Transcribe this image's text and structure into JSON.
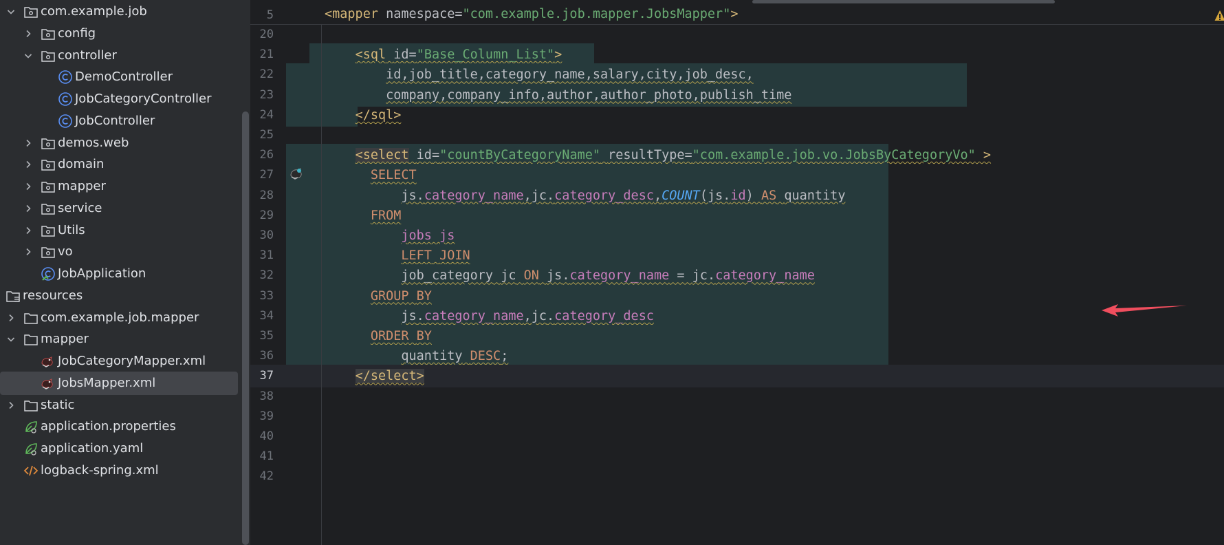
{
  "tree": {
    "items": [
      {
        "label": "com.example.job",
        "indent": 0,
        "chevron": "down",
        "icon": "package-icon"
      },
      {
        "label": "config",
        "indent": 1,
        "chevron": "right",
        "icon": "package-icon"
      },
      {
        "label": "controller",
        "indent": 1,
        "chevron": "down",
        "icon": "package-icon"
      },
      {
        "label": "DemoController",
        "indent": 2,
        "chevron": "",
        "icon": "class-icon"
      },
      {
        "label": "JobCategoryController",
        "indent": 2,
        "chevron": "",
        "icon": "class-icon"
      },
      {
        "label": "JobController",
        "indent": 2,
        "chevron": "",
        "icon": "class-icon"
      },
      {
        "label": "demos.web",
        "indent": 1,
        "chevron": "right",
        "icon": "package-icon"
      },
      {
        "label": "domain",
        "indent": 1,
        "chevron": "right",
        "icon": "package-icon"
      },
      {
        "label": "mapper",
        "indent": 1,
        "chevron": "right",
        "icon": "package-icon"
      },
      {
        "label": "service",
        "indent": 1,
        "chevron": "right",
        "icon": "package-icon"
      },
      {
        "label": "Utils",
        "indent": 1,
        "chevron": "right",
        "icon": "package-icon"
      },
      {
        "label": "vo",
        "indent": 1,
        "chevron": "right",
        "icon": "package-icon"
      },
      {
        "label": "JobApplication",
        "indent": 1,
        "chevron": "",
        "icon": "spring-app-icon"
      },
      {
        "label": "resources",
        "indent": -1,
        "chevron": "",
        "icon": "resources-folder-icon"
      },
      {
        "label": "com.example.job.mapper",
        "indent": 0,
        "chevron": "right",
        "icon": "folder-icon"
      },
      {
        "label": "mapper",
        "indent": 0,
        "chevron": "down",
        "icon": "folder-icon"
      },
      {
        "label": "JobCategoryMapper.xml",
        "indent": 1,
        "chevron": "",
        "icon": "mybatis-xml-icon"
      },
      {
        "label": "JobsMapper.xml",
        "indent": 1,
        "chevron": "",
        "icon": "mybatis-xml-icon",
        "selected": true
      },
      {
        "label": "static",
        "indent": 0,
        "chevron": "right",
        "icon": "folder-icon"
      },
      {
        "label": "application.properties",
        "indent": 0,
        "chevron": "",
        "icon": "spring-config-icon"
      },
      {
        "label": "application.yaml",
        "indent": 0,
        "chevron": "",
        "icon": "spring-config-icon"
      },
      {
        "label": "logback-spring.xml",
        "indent": 0,
        "chevron": "",
        "icon": "xml-file-icon"
      }
    ]
  },
  "editor": {
    "sticky": {
      "num": "5",
      "text": "<mapper namespace=\"com.example.job.mapper.JobsMapper\">"
    },
    "current_line": "37",
    "lines": [
      {
        "num": "20",
        "text": ""
      },
      {
        "num": "21",
        "text": "    <sql id=\"Base_Column_List\">"
      },
      {
        "num": "22",
        "text": "        id,job_title,category_name,salary,city,job_desc,"
      },
      {
        "num": "23",
        "text": "        company,company_info,author,author_photo,publish_time"
      },
      {
        "num": "24",
        "text": "    </sql>"
      },
      {
        "num": "25",
        "text": ""
      },
      {
        "num": "26",
        "text": "    <select id=\"countByCategoryName\" resultType=\"com.example.job.vo.JobsByCategoryVo\" >"
      },
      {
        "num": "27",
        "text": "      SELECT"
      },
      {
        "num": "28",
        "text": "          js.category_name,jc.category_desc,COUNT(js.id) AS quantity"
      },
      {
        "num": "29",
        "text": "      FROM"
      },
      {
        "num": "30",
        "text": "          jobs js"
      },
      {
        "num": "31",
        "text": "          LEFT JOIN"
      },
      {
        "num": "32",
        "text": "          job_category jc ON js.category_name = jc.category_name"
      },
      {
        "num": "33",
        "text": "      GROUP BY"
      },
      {
        "num": "34",
        "text": "          js.category_name,jc.category_desc"
      },
      {
        "num": "35",
        "text": "      ORDER BY"
      },
      {
        "num": "36",
        "text": "          quantity DESC;"
      },
      {
        "num": "37",
        "text": "    </select>"
      },
      {
        "num": "38",
        "text": ""
      },
      {
        "num": "39",
        "text": ""
      },
      {
        "num": "40",
        "text": ""
      },
      {
        "num": "41",
        "text": ""
      },
      {
        "num": "42",
        "text": ""
      }
    ]
  },
  "icons": {
    "warning": "warning-icon",
    "gutter": "mybatis-navigation-icon",
    "annotation": "red-arrow-annotation"
  },
  "colors": {
    "tree_bg": "#2b2d30",
    "editor_bg": "#1e1f22",
    "sql_highlight": "#263a3c",
    "tag": "#d5b778",
    "string": "#6aab73",
    "keyword": "#cf8e6d",
    "field": "#c77dbb",
    "function": "#56a8f5",
    "arrow": "#f04e5e"
  }
}
